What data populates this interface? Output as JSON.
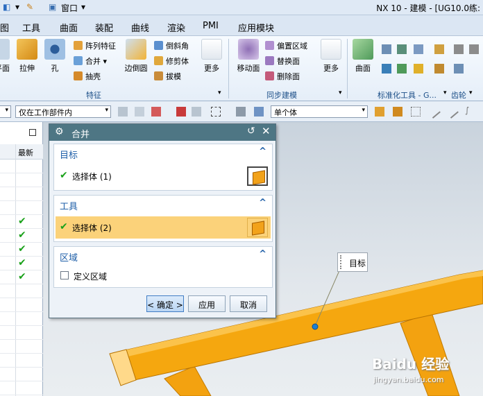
{
  "titlebar": {
    "window_menu": "窗口",
    "app_title": "NX 10 - 建模 - [UG10.0练:"
  },
  "menubar": {
    "items": [
      "图",
      "工具",
      "曲面",
      "装配",
      "曲线",
      "渲染",
      "PMI",
      "应用模块"
    ]
  },
  "ribbon": {
    "features": {
      "extrude": "拉伸",
      "hole": "孔",
      "pattern_feature": "阵列特征",
      "unite": "合并",
      "shell": "抽壳",
      "edge_blend": "边倒圆",
      "chamfer": "倒斜角",
      "trim_body": "修剪体",
      "draft": "拔模",
      "more": "更多",
      "group_label": "特征",
      "partial_left": "平面"
    },
    "sync": {
      "move_face": "移动面",
      "offset_region": "偏置区域",
      "replace_face": "替换面",
      "delete_face": "删除面",
      "more": "更多",
      "group_label": "同步建模"
    },
    "surface": {
      "surface": "曲面",
      "standard_tools": "标准化工具 - G...",
      "gear": "齿轮"
    }
  },
  "selection_bar": {
    "scope": "仅在工作部件内",
    "body_filter": "单个体"
  },
  "part_navigator": {
    "latest_header": "最新",
    "checkmarks": 5
  },
  "dialog": {
    "title": "合并",
    "target": {
      "title": "目标",
      "select_label": "选择体 (1)"
    },
    "tool": {
      "title": "工具",
      "select_label": "选择体 (2)"
    },
    "region": {
      "title": "区域",
      "define_region": "定义区域"
    },
    "buttons": {
      "ok": "< 确定 >",
      "apply": "应用",
      "cancel": "取消"
    }
  },
  "viewport": {
    "callout": "目标"
  },
  "watermark": {
    "brand": "Baidu 经验",
    "url": "jingyan.baidu.com"
  },
  "colors": {
    "dialog_title": "#4e7684",
    "section_title": "#1f5fa8",
    "highlight_row": "#fbd27a",
    "body_orange": "#f5a70f",
    "check_green": "#1aa11a"
  }
}
